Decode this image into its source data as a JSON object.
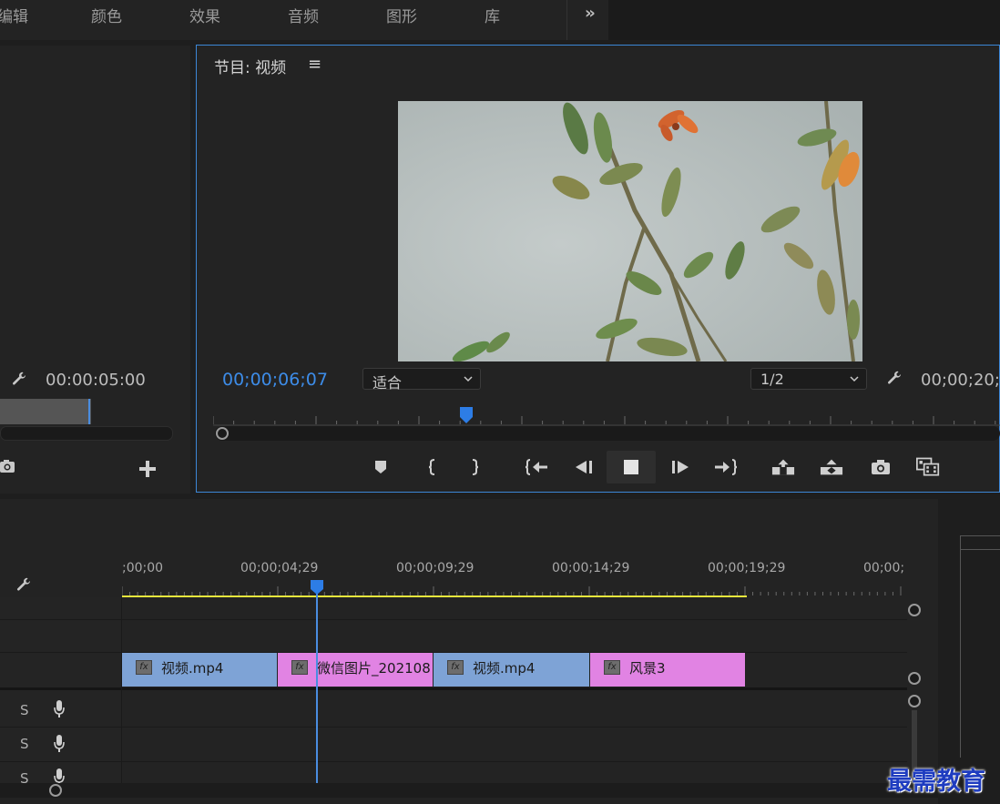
{
  "workspace_tabs": [
    "编辑",
    "颜色",
    "效果",
    "音频",
    "图形",
    "库"
  ],
  "icons": {
    "more": "chevron-double-right-icon",
    "wrench": "wrench-icon",
    "menu": "hamburger-menu-icon",
    "marker": "marker-icon",
    "mark_in": "mark-in-icon",
    "mark_out": "mark-out-icon",
    "go_to_in": "go-to-in-icon",
    "step_back": "step-back-icon",
    "stop": "stop-icon",
    "step_forward": "step-forward-icon",
    "go_to_out": "go-to-out-icon",
    "lift": "lift-icon",
    "extract": "extract-icon",
    "export_frame": "camera-icon",
    "button_editor": "button-editor-icon",
    "add": "plus-icon",
    "mic": "microphone-icon"
  },
  "source_monitor": {
    "timecode": "00:00:05:00"
  },
  "program_monitor": {
    "title": "节目: 视频",
    "timecode": "00;00;06;07",
    "fit_option": "适合",
    "resolution": "1/2",
    "duration": "00;00;20;",
    "playhead_fraction": 0.32
  },
  "timeline": {
    "ruler_labels": [
      ";00;00",
      "00;00;04;29",
      "00;00;09;29",
      "00;00;14;29",
      "00;00;19;29",
      "00;00;"
    ],
    "clips": [
      {
        "name": "视频.mp4",
        "color": "#7ea3d6"
      },
      {
        "name": "微信图片_202108",
        "color": "#e183e3"
      },
      {
        "name": "视频.mp4",
        "color": "#7ea3d6"
      },
      {
        "name": "风景3",
        "color": "#e183e3"
      }
    ],
    "audio_track_labels": [
      "S",
      "S",
      "S"
    ]
  },
  "colors": {
    "accent_blue": "#3d8ce8",
    "work_area": "#e6e63c",
    "video_clip": "#7ea3d6",
    "image_clip": "#e183e3"
  },
  "watermark": "最需教育"
}
